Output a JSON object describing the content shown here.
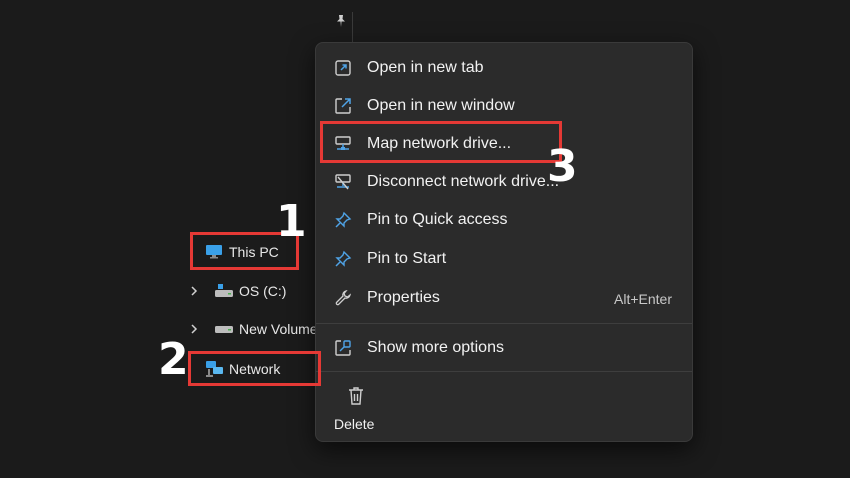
{
  "nav_pane": {
    "items": [
      {
        "label": "This PC",
        "icon": "monitor-icon"
      },
      {
        "label": "OS (C:)",
        "icon": "drive-icon"
      },
      {
        "label": "New Volume",
        "icon": "drive-icon"
      },
      {
        "label": "Network",
        "icon": "network-icon"
      }
    ]
  },
  "context_menu": {
    "items": [
      {
        "label": "Open in new tab",
        "icon": "open-new-tab-icon"
      },
      {
        "label": "Open in new window",
        "icon": "open-new-window-icon"
      },
      {
        "label": "Map network drive...",
        "icon": "map-network-drive-icon"
      },
      {
        "label": "Disconnect network drive...",
        "icon": "disconnect-network-drive-icon"
      },
      {
        "label": "Pin to Quick access",
        "icon": "pin-icon"
      },
      {
        "label": "Pin to Start",
        "icon": "pin-icon"
      },
      {
        "label": "Properties",
        "icon": "wrench-icon",
        "accelerator": "Alt+Enter"
      },
      {
        "label": "Show more options",
        "icon": "show-more-icon"
      }
    ],
    "delete": {
      "label": "Delete",
      "icon": "trash-icon"
    }
  },
  "annotations": {
    "steps": [
      "1",
      "2",
      "3"
    ],
    "highlight_color": "#e53935"
  },
  "colors": {
    "background": "#1b1b1b",
    "menu_background": "#2b2b2b",
    "icon_accent": "#4fa3e6"
  }
}
